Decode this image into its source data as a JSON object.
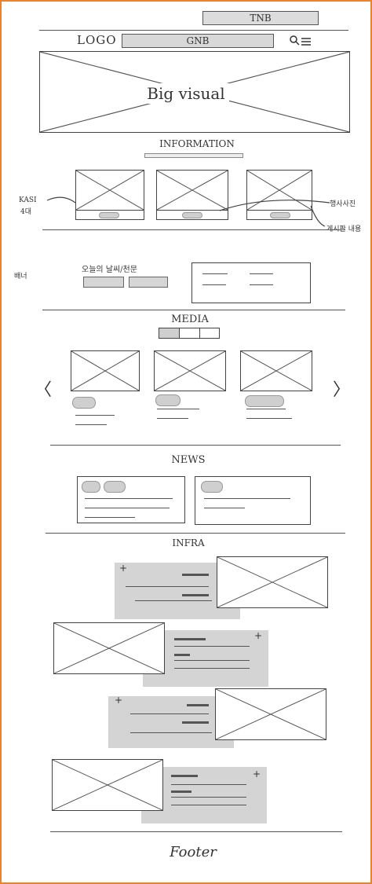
{
  "tnb": {
    "label": "TNB"
  },
  "header": {
    "logo": "LOGO",
    "gnb": "GNB"
  },
  "hero": {
    "label": "Big visual"
  },
  "information": {
    "title": "INFORMATION",
    "annotation_left_1": "KASI",
    "annotation_left_2": "4대",
    "annotation_right_1": "행사사진",
    "annotation_right_2": "게시판 내용"
  },
  "banner": {
    "title": "오늘의 날씨/천문",
    "side_note": "배너"
  },
  "media": {
    "title": "MEDIA",
    "prev_glyph": "〈",
    "next_glyph": "〉"
  },
  "news": {
    "title": "NEWS"
  },
  "infra": {
    "title": "INFRA",
    "plus_glyph": "+"
  },
  "footer": {
    "label": "Footer"
  }
}
